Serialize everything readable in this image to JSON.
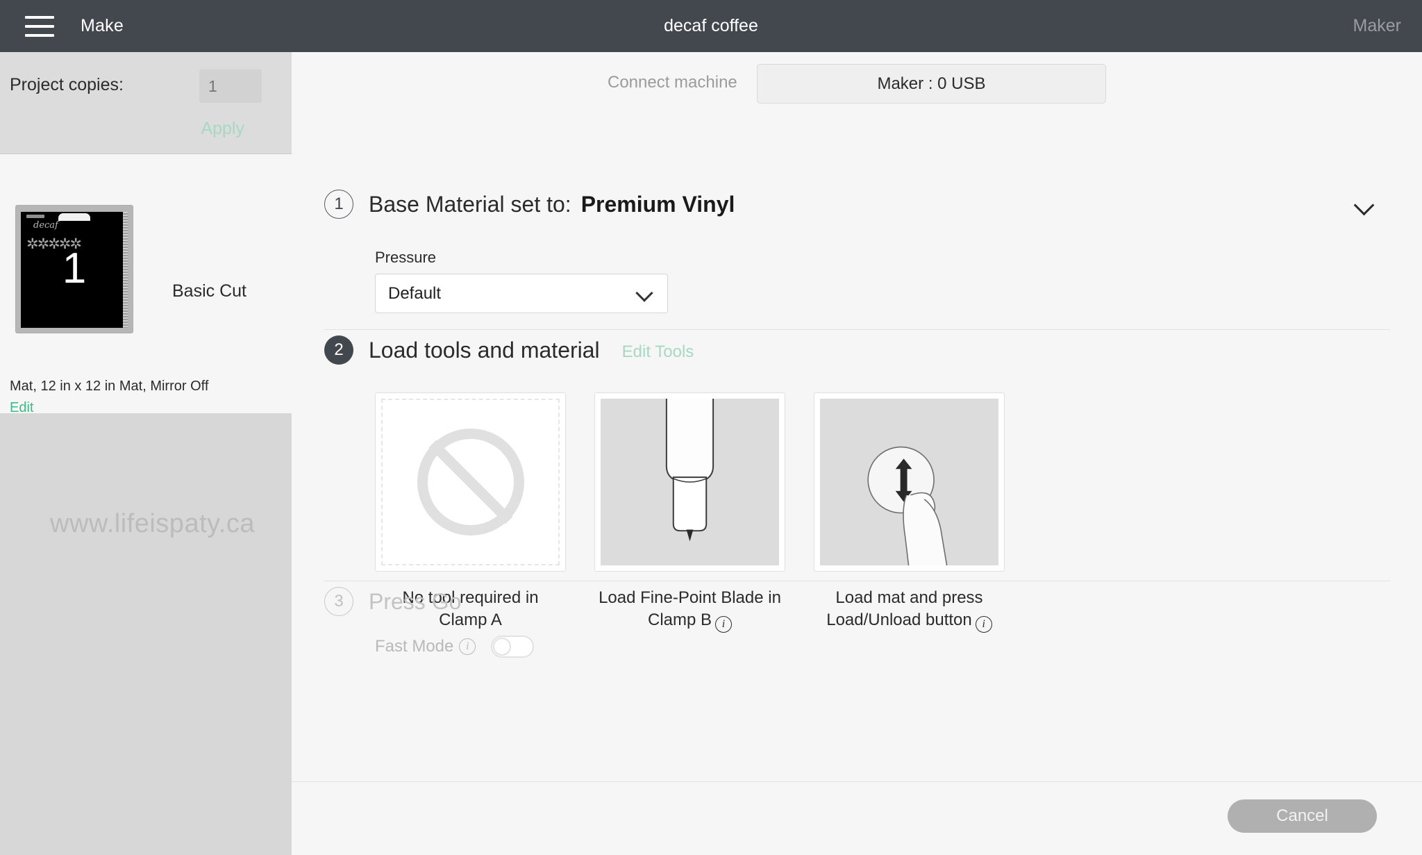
{
  "topbar": {
    "menu_icon": "hamburger-icon",
    "make_label": "Make",
    "project_title": "decaf coffee",
    "machine_label": "Maker"
  },
  "sidebar": {
    "copies": {
      "label": "Project copies:",
      "value": "1",
      "placeholder": "1",
      "apply_label": "Apply"
    },
    "mat": {
      "number": "1",
      "cut_type": "Basic Cut",
      "script_text": "decaf",
      "description": "Mat, 12 in x 12 in Mat, Mirror Off",
      "edit_label": "Edit"
    },
    "watermark": "www.lifeispaty.ca"
  },
  "main": {
    "connect": {
      "label": "Connect machine",
      "machine_button": "Maker : 0 USB"
    },
    "step1": {
      "number": "1",
      "title": "Base Material set to:",
      "value": "Premium Vinyl",
      "pressure_label": "Pressure",
      "pressure_value": "Default",
      "collapse_icon": "chevron-down-icon"
    },
    "step2": {
      "number": "2",
      "title": "Load tools and material",
      "edit_tools_label": "Edit Tools",
      "cards": [
        {
          "icon": "no-tool-icon",
          "line1": "No tool required in",
          "line2": "Clamp A",
          "has_info": false
        },
        {
          "icon": "fine-point-blade-icon",
          "line1": "Load Fine-Point Blade in",
          "line2": "Clamp B",
          "has_info": true
        },
        {
          "icon": "load-mat-press-button-icon",
          "line1": "Load mat and press",
          "line2": "Load/Unload button",
          "has_info": true
        }
      ]
    },
    "step3": {
      "number": "3",
      "title": "Press Go",
      "fast_mode_label": "Fast Mode",
      "fast_mode_on": false
    }
  },
  "footer": {
    "cancel_label": "Cancel"
  },
  "colors": {
    "topbar_bg": "#43474e",
    "accent_green": "#3cba8b",
    "accent_green_faded": "#a6d8c2",
    "page_bg": "#f6f6f6",
    "panel_gray": "#dcdcdc",
    "cancel_gray": "#b0b0b0"
  }
}
